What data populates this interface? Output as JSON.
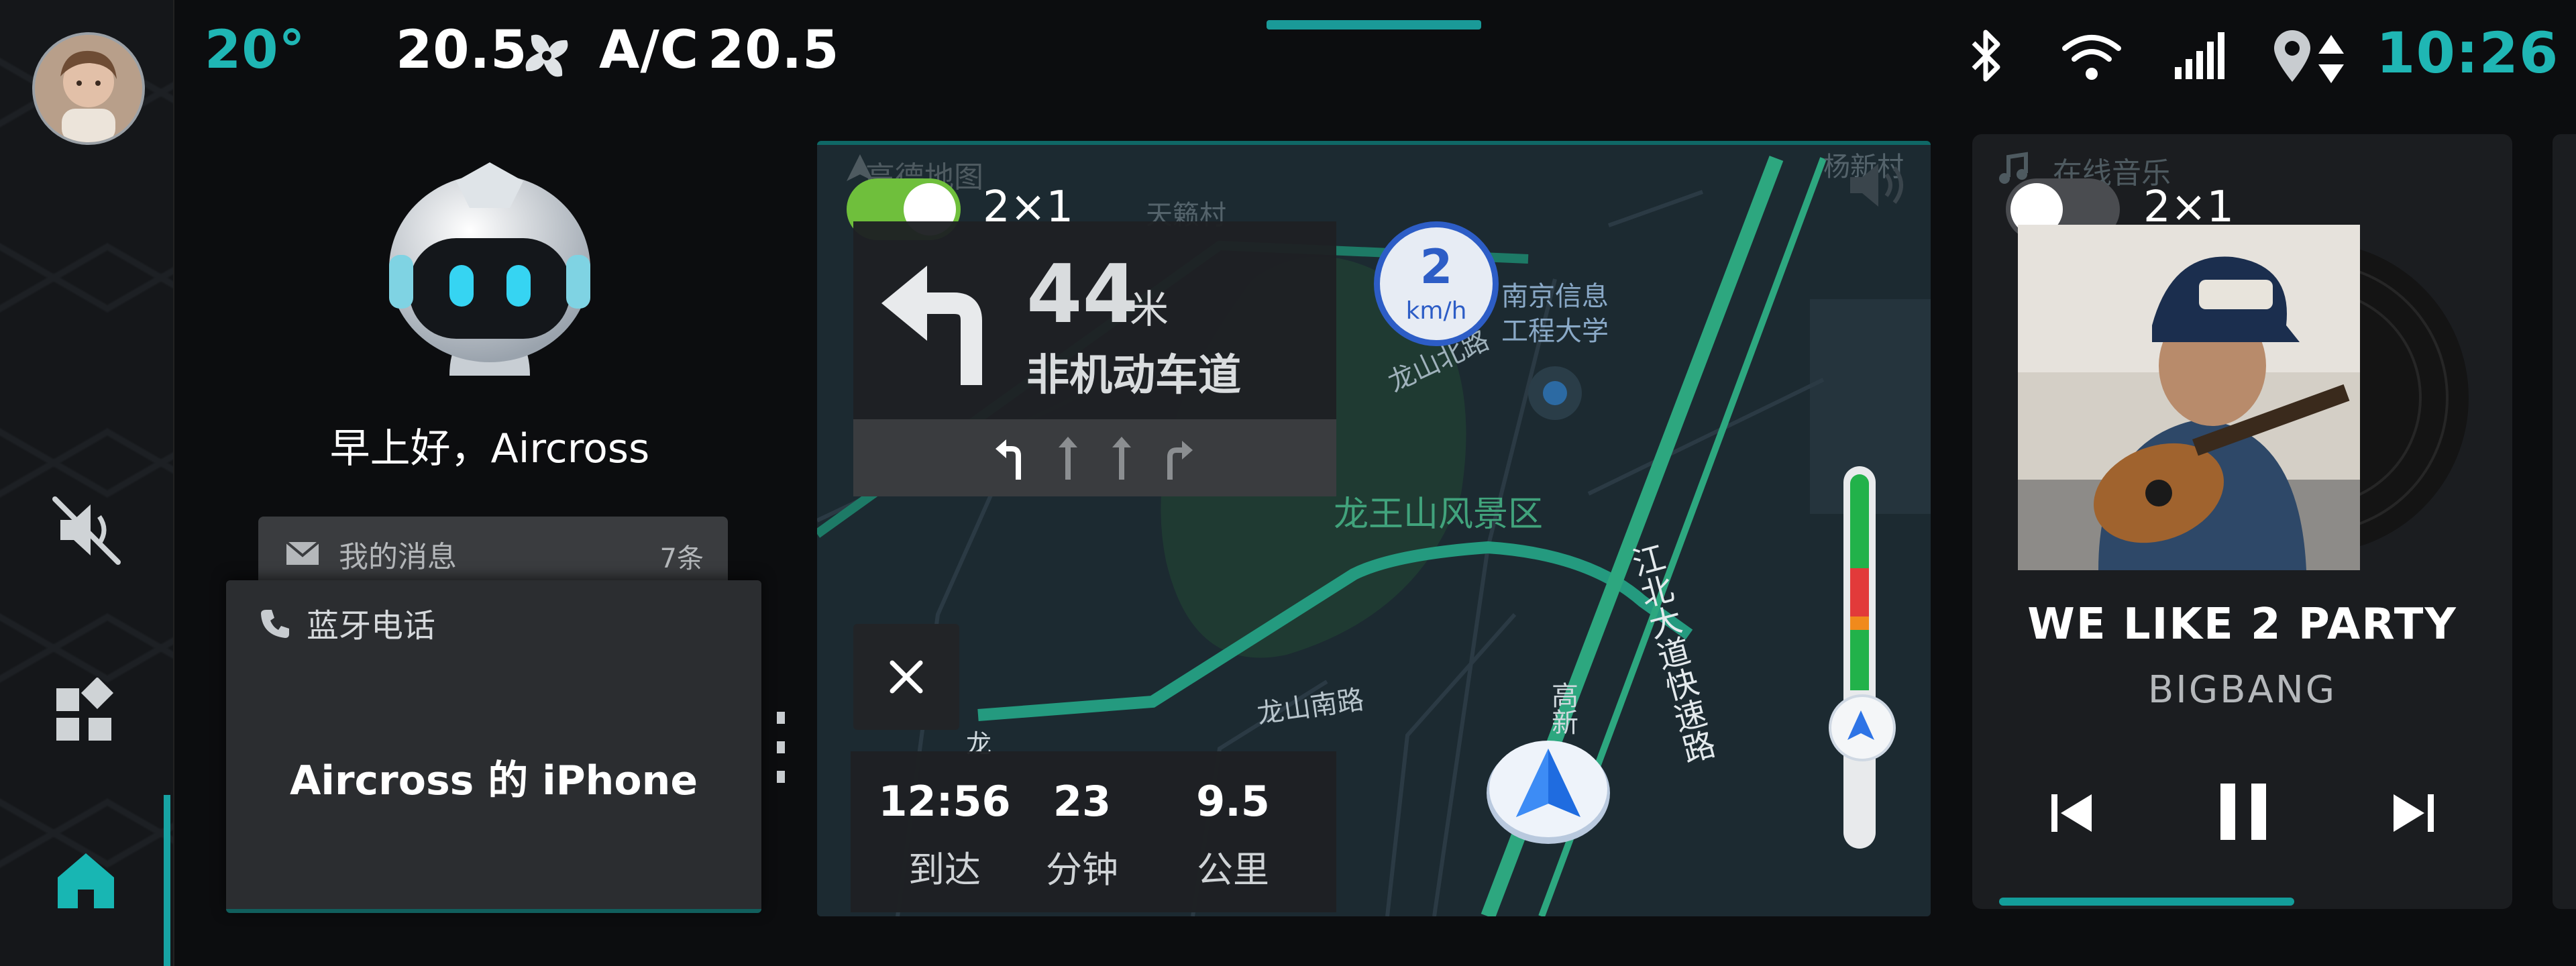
{
  "status": {
    "temp_outside": "20°",
    "temp_left": "20.5",
    "ac_label": "A/C",
    "temp_right": "20.5",
    "clock": "10:26"
  },
  "assistant": {
    "greeting": "早上好，Aircross"
  },
  "messages": {
    "label": "我的消息",
    "count": "7条"
  },
  "phone": {
    "label": "蓝牙电话",
    "device": "Aircross 的 iPhone"
  },
  "map": {
    "app_name": "高德地图",
    "widget_size": "2×1",
    "distance": "44",
    "distance_unit": "米",
    "road": "非机动车道",
    "speed_value": "2",
    "speed_unit": "km/h",
    "eta_time": "12:56",
    "eta_time_label": "到达",
    "eta_minutes": "23",
    "eta_minutes_label": "分钟",
    "eta_km": "9.5",
    "eta_km_label": "公里",
    "labels": {
      "tianlai": "天籁村",
      "university": "南京信息\n工程大学",
      "longshan_n": "龙山北路",
      "scenic": "龙王山风景区",
      "longshan_s": "龙山南路",
      "expressway": "江北大道快速路",
      "gaoxin": "高新",
      "long": "龙",
      "yangxin": "杨新村"
    }
  },
  "music": {
    "app_name": "在线音乐",
    "widget_size": "2×1",
    "title": "WE LIKE 2 PARTY",
    "artist": "BIGBANG"
  },
  "colors": {
    "accent": "#1fb6b4",
    "toggle_on": "#6fbf3c",
    "toggle_off": "#4a4c50",
    "traffic_green": "#22b24a",
    "traffic_red": "#e23a3a",
    "traffic_orange": "#f08a1c"
  }
}
